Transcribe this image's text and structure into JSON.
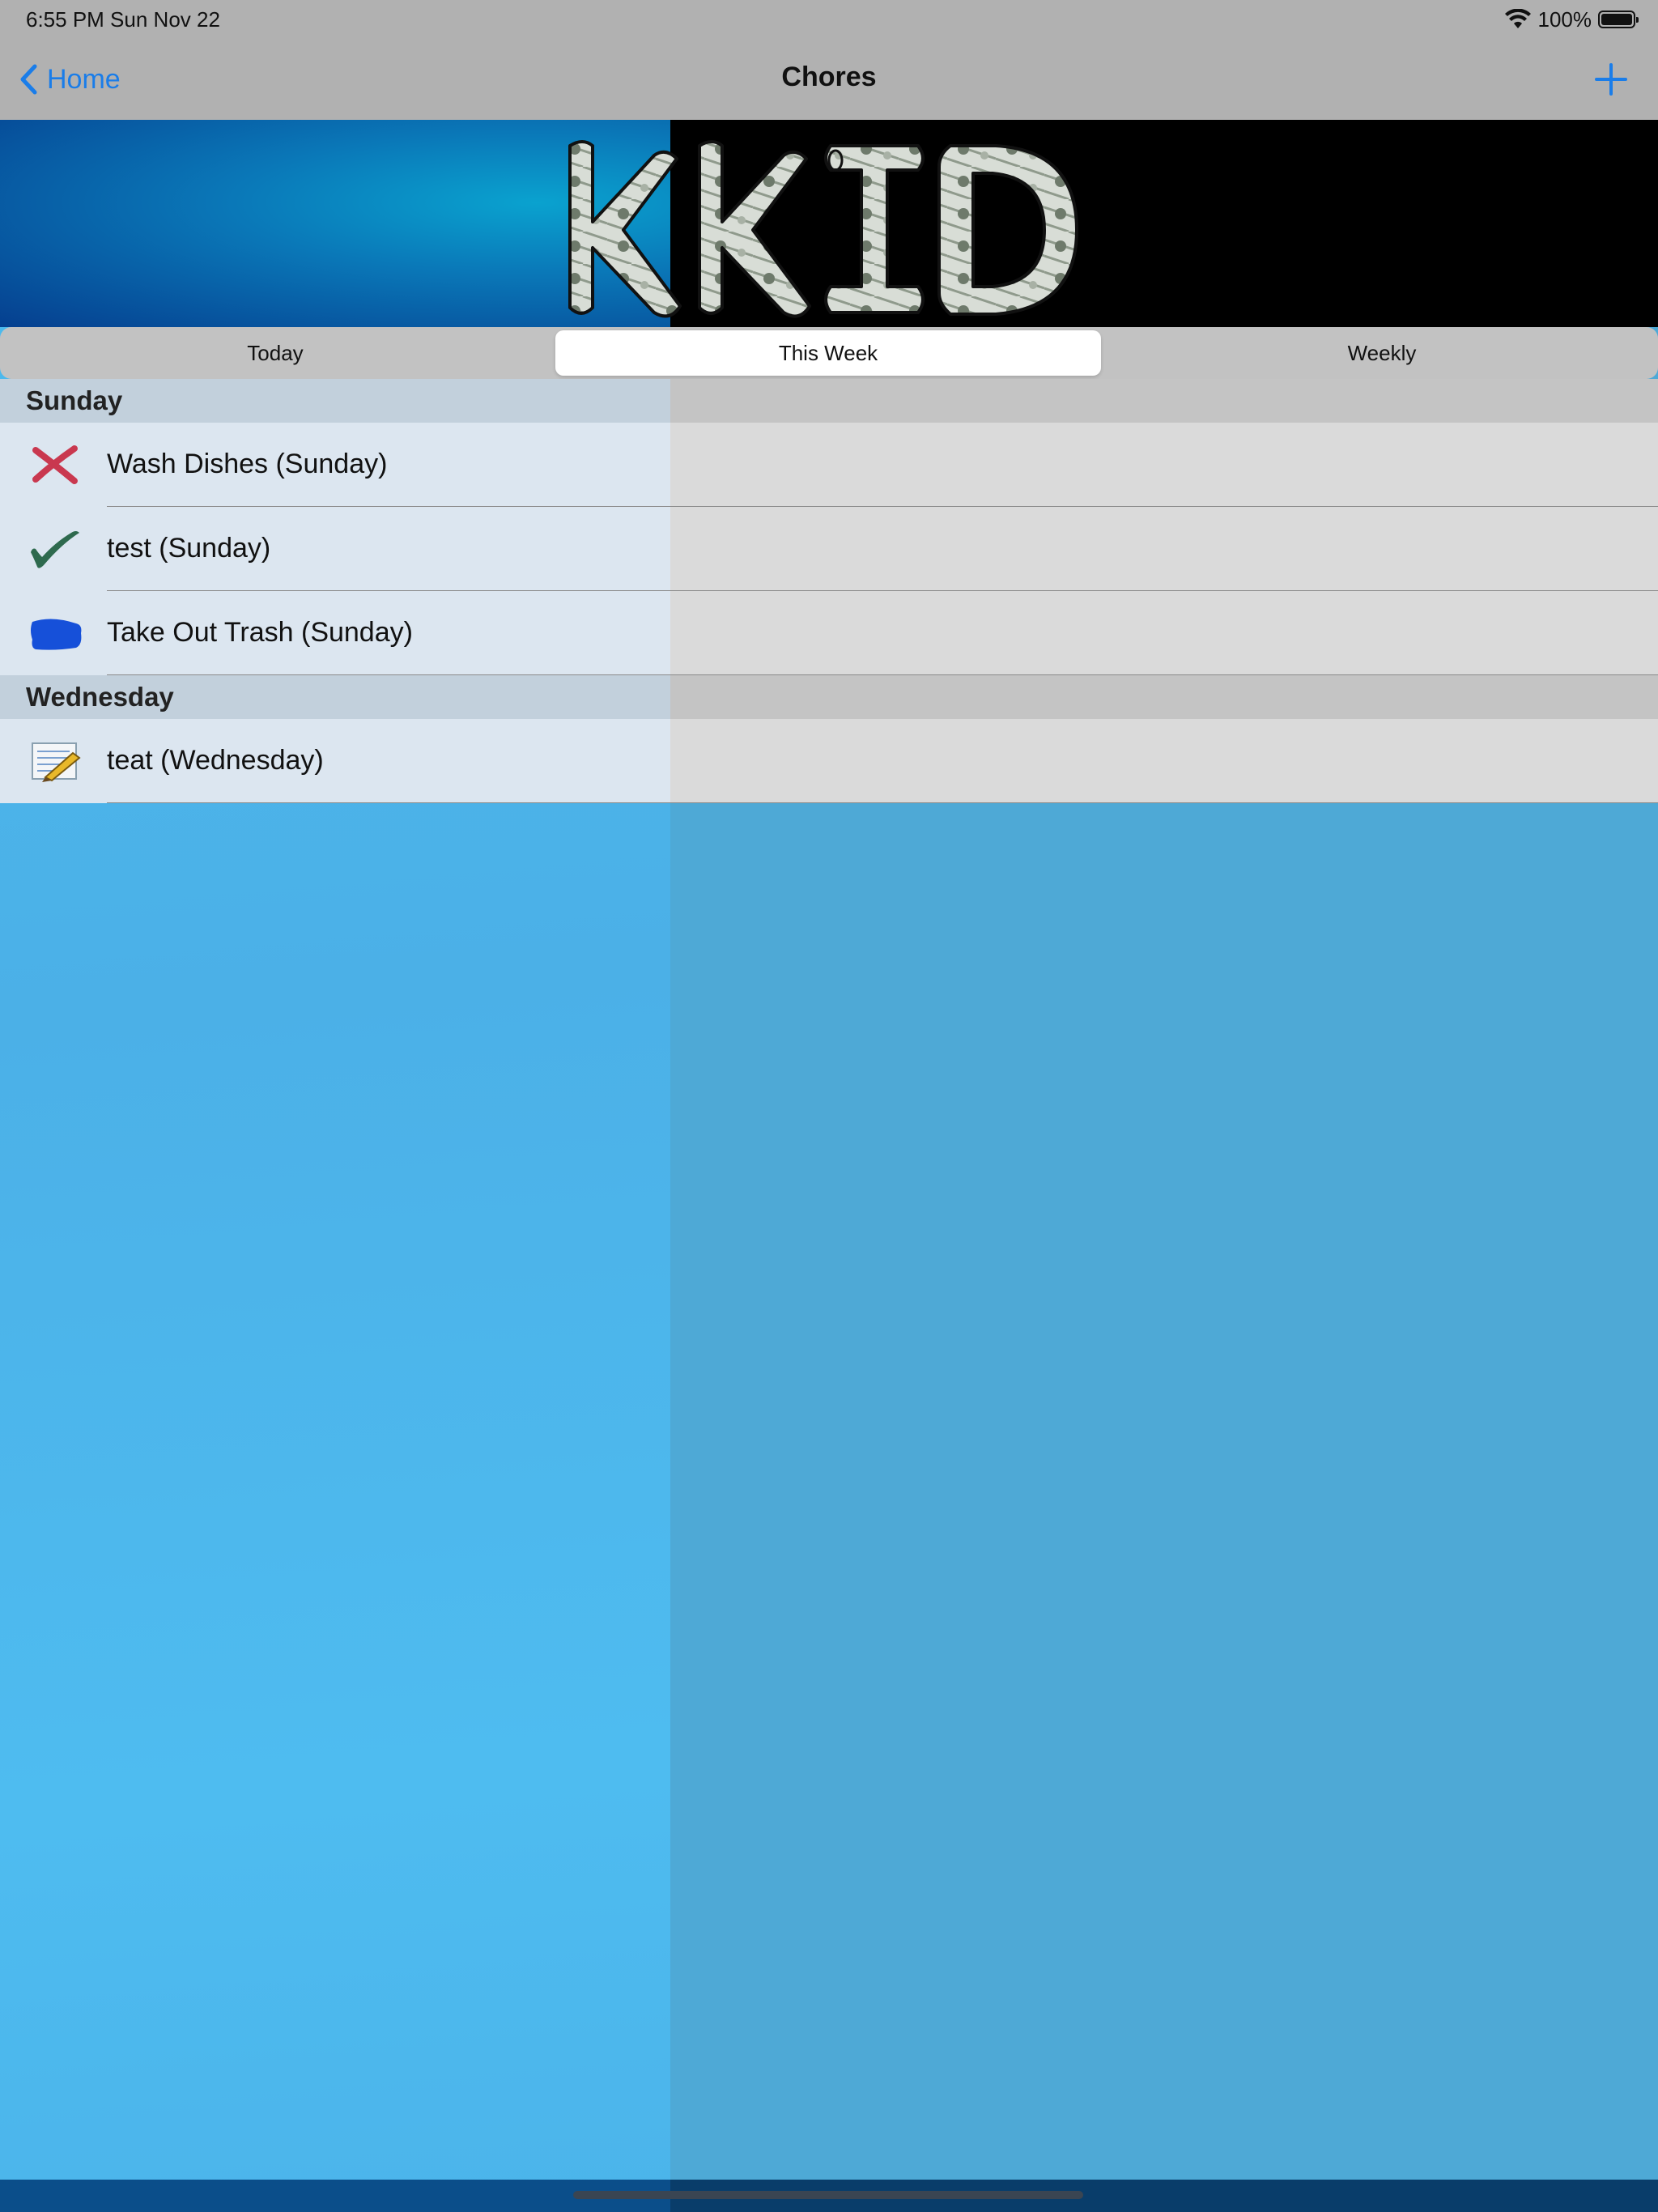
{
  "status_bar": {
    "time": "6:55 PM   Sun Nov 22",
    "battery": "100%"
  },
  "nav": {
    "back_label": "Home",
    "title": "Chores"
  },
  "banner": {
    "logo_text": "KKID"
  },
  "segments": [
    {
      "label": "Today",
      "selected": false
    },
    {
      "label": "This Week",
      "selected": true
    },
    {
      "label": "Weekly",
      "selected": false
    }
  ],
  "sections": [
    {
      "title": "Sunday",
      "rows": [
        {
          "label": "Wash Dishes (Sunday)",
          "icon": "red-x-icon"
        },
        {
          "label": "test (Sunday)",
          "icon": "green-check-icon"
        },
        {
          "label": "Take Out Trash (Sunday)",
          "icon": "blue-blob-icon"
        }
      ]
    },
    {
      "title": "Wednesday",
      "rows": [
        {
          "label": "teat (Wednesday)",
          "icon": "notepad-pencil-icon"
        }
      ]
    }
  ],
  "colors": {
    "accent": "#1a7de9",
    "x_red": "#c9384f",
    "check_green": "#2e6a4e",
    "blob_blue": "#1650d9"
  }
}
